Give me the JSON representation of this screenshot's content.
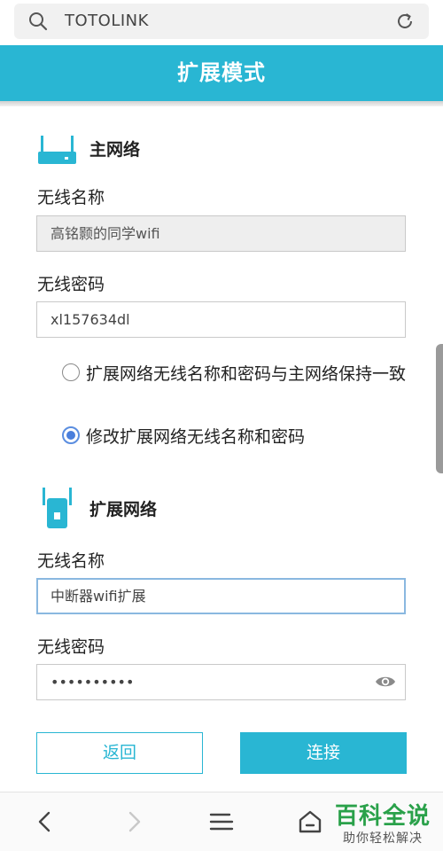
{
  "browser": {
    "url": "TOTOLINK",
    "icons": [
      "search-icon",
      "reload-icon"
    ]
  },
  "header": {
    "title": "扩展模式"
  },
  "main_network": {
    "title": "主网络",
    "icon": "router-icon",
    "ssid_label": "无线名称",
    "ssid_value": "高铭颢的同学wifi",
    "password_label": "无线密码",
    "password_value": "xl157634dl"
  },
  "options": [
    {
      "label": "扩展网络无线名称和密码与主网络保持一致",
      "checked": false
    },
    {
      "label": "修改扩展网络无线名称和密码",
      "checked": true
    }
  ],
  "extend_network": {
    "title": "扩展网络",
    "icon": "repeater-icon",
    "ssid_label": "无线名称",
    "ssid_value": "中断器wifi扩展",
    "password_label": "无线密码",
    "password_masked": "••••••••••"
  },
  "buttons": {
    "back": "返回",
    "connect": "连接"
  },
  "bottom_nav": {
    "icons": [
      "back-arrow-icon",
      "forward-arrow-icon",
      "menu-icon",
      "home-icon"
    ]
  },
  "watermark": {
    "title": "百科全说",
    "subtitle": "助你轻松解决"
  },
  "colors": {
    "accent": "#29b6d3",
    "radio": "#4a7fdc",
    "watermark": "#2aa14a"
  }
}
